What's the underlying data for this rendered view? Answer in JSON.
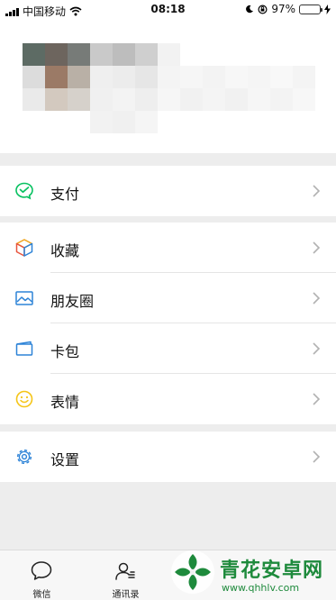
{
  "status_bar": {
    "carrier": "中国移动",
    "time": "08:18",
    "battery_percent_text": "97%",
    "battery_level": 0.97
  },
  "profile": {
    "avatar_state": "pixelated"
  },
  "menu": {
    "pay": {
      "label": "支付",
      "icon": "wechat-pay-icon"
    },
    "favorites": {
      "label": "收藏",
      "icon": "cube-icon"
    },
    "moments": {
      "label": "朋友圈",
      "icon": "image-icon"
    },
    "cards": {
      "label": "卡包",
      "icon": "card-icon"
    },
    "stickers": {
      "label": "表情",
      "icon": "smiley-icon"
    },
    "settings": {
      "label": "设置",
      "icon": "gear-icon"
    }
  },
  "tabbar": {
    "tabs": [
      {
        "label": "微信",
        "icon": "chat-bubble-icon"
      },
      {
        "label": "通讯录",
        "icon": "contacts-icon"
      }
    ]
  },
  "watermark": {
    "title": "青花安卓网",
    "url": "www.qhhlv.com"
  },
  "colors": {
    "background": "#ededed",
    "pay_green": "#07c160",
    "link_blue": "#2d83d7",
    "sticker_yellow": "#f5c518",
    "watermark_green": "#1e8a3c"
  }
}
